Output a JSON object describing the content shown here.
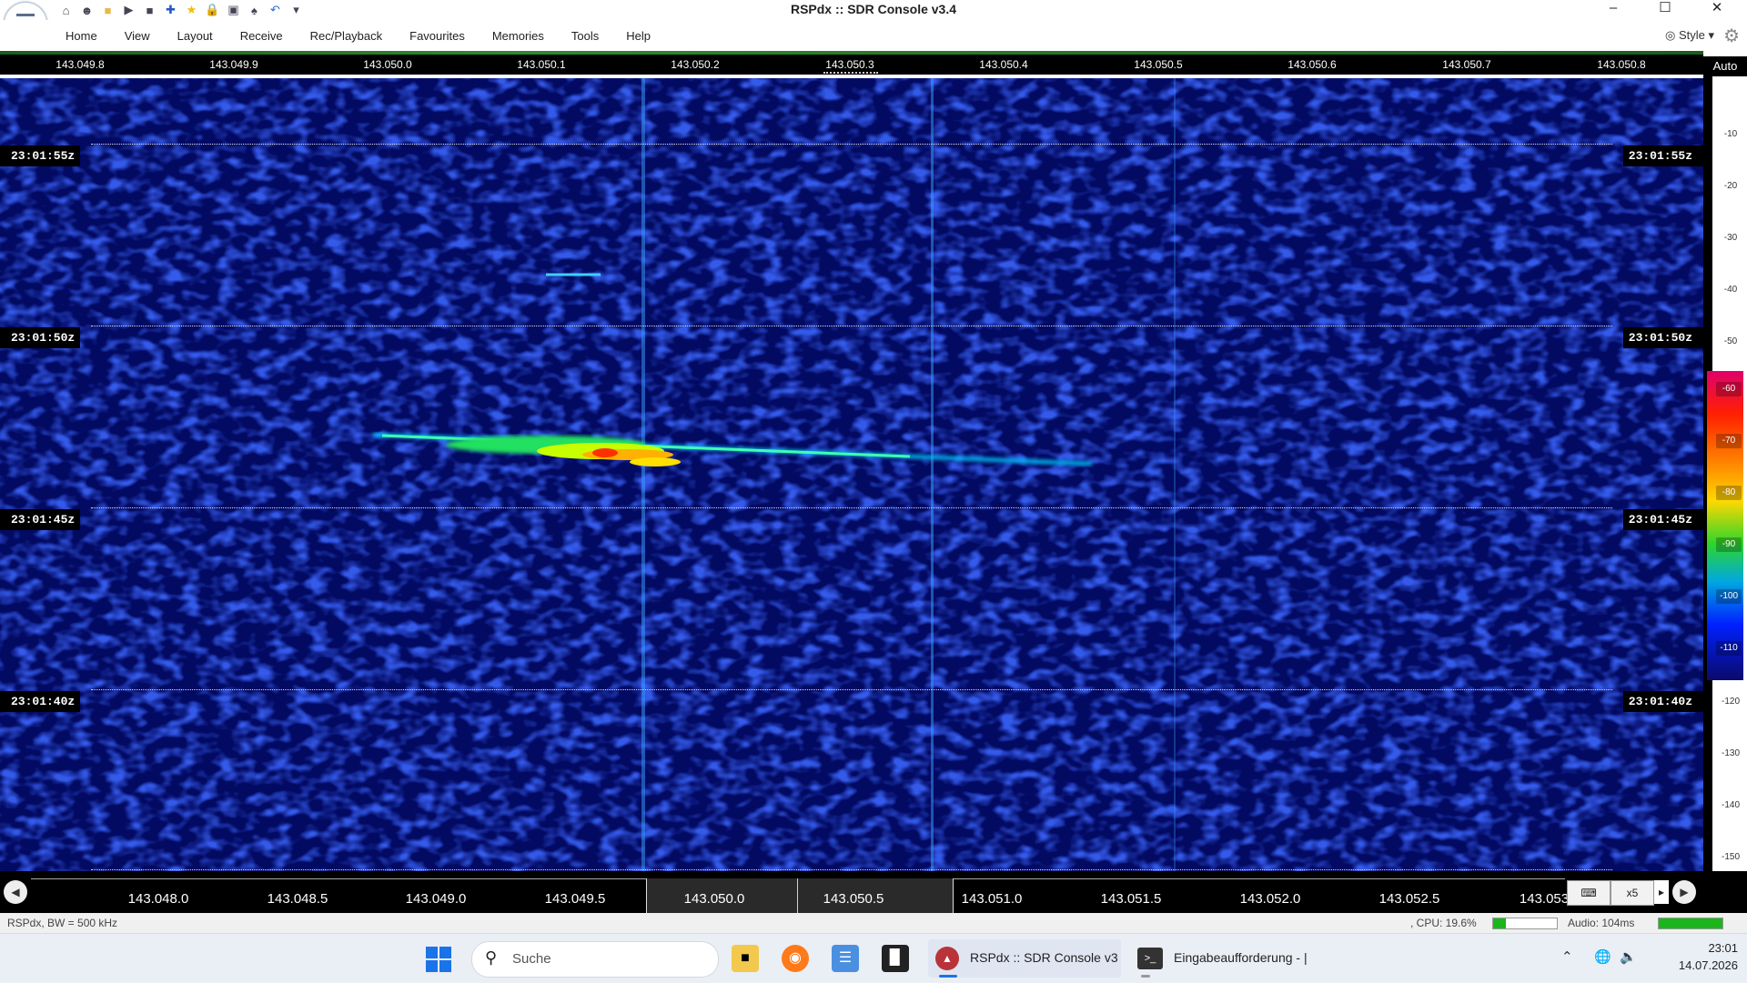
{
  "window": {
    "title": "RSPdx :: SDR Console v3.4",
    "minimize": "–",
    "maximize": "☐",
    "close": "✕"
  },
  "quick_access": [
    "home-icon",
    "users-icon",
    "folder-icon",
    "play-icon",
    "stop-icon",
    "plus-icon",
    "star-icon",
    "lock-icon",
    "camera-icon",
    "user-icon",
    "undo-icon",
    "dropdown-icon"
  ],
  "menu": {
    "items": [
      "Home",
      "View",
      "Layout",
      "Receive",
      "Rec/Playback",
      "Favourites",
      "Memories",
      "Tools",
      "Help"
    ],
    "style_label": "Style"
  },
  "freq_top": [
    "143.049.8",
    "143.049.9",
    "143.050.0",
    "143.050.1",
    "143.050.2",
    "143.050.3",
    "143.050.4",
    "143.050.5",
    "143.050.6",
    "143.050.7",
    "143.050.8"
  ],
  "waterfall": {
    "times": [
      "23:01:55z",
      "23:01:50z",
      "23:01:45z",
      "23:01:40z"
    ]
  },
  "scale": {
    "auto_label": "Auto",
    "ticks": [
      "-10",
      "-20",
      "-30",
      "-40",
      "-50",
      "-60",
      "-70",
      "-80",
      "-90",
      "-100",
      "-110",
      "-120",
      "-130",
      "-140",
      "-150"
    ]
  },
  "freq_bottom": {
    "labels": [
      "143.048.0",
      "143.048.5",
      "143.049.0",
      "143.049.5",
      "143.050.0",
      "143.050.5",
      "143.051.0",
      "143.051.5",
      "143.052.0",
      "143.052.5",
      "143.053"
    ],
    "zoom": "x5"
  },
  "status": {
    "left": "RSPdx, BW = 500 kHz",
    "cpu": ", CPU: 19.6%",
    "cpu_fraction": 0.196,
    "audio": "Audio: 104ms"
  },
  "taskbar": {
    "search_placeholder": "Suche",
    "app1": "RSPdx :: SDR Console v3",
    "app2": "Eingabeaufforderung - |",
    "time": "23:01",
    "date": "14.07.2026"
  },
  "colors": {
    "waterfall_bg": "#020a5c",
    "signal": "#00e0ff",
    "accent": "#1a73e8",
    "status_green": "#1cb51c"
  }
}
